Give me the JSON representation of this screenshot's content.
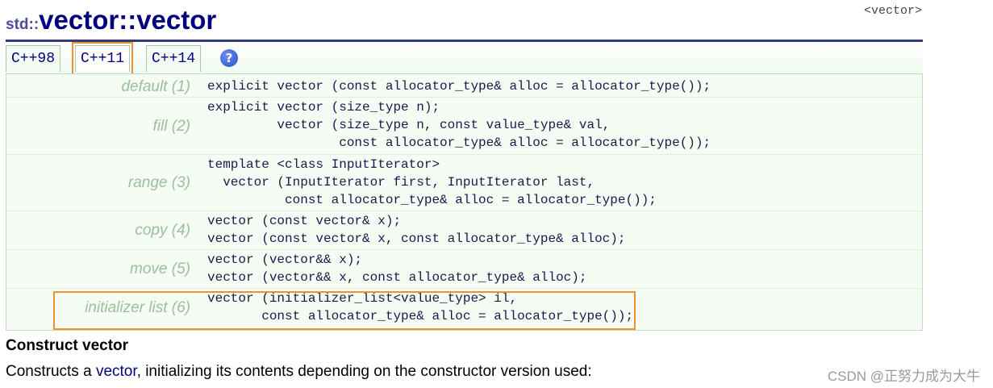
{
  "header": {
    "namespace": "std::",
    "class_name": "vector",
    "separator": "::",
    "member_name": "vector",
    "header_tag": "<vector>"
  },
  "tabs": [
    {
      "label": "C++98",
      "active": false
    },
    {
      "label": "C++11",
      "active": true
    },
    {
      "label": "C++14",
      "active": false
    }
  ],
  "help_icon": "?",
  "constructors": [
    {
      "label": "default (1)",
      "code": "explicit vector (const allocator_type& alloc = allocator_type());"
    },
    {
      "label": "fill (2)",
      "code": "explicit vector (size_type n);\n         vector (size_type n, const value_type& val,\n                 const allocator_type& alloc = allocator_type());"
    },
    {
      "label": "range (3)",
      "code": "template <class InputIterator>\n  vector (InputIterator first, InputIterator last,\n          const allocator_type& alloc = allocator_type());"
    },
    {
      "label": "copy (4)",
      "code": "vector (const vector& x);\nvector (const vector& x, const allocator_type& alloc);"
    },
    {
      "label": "move (5)",
      "code": "vector (vector&& x);\nvector (vector&& x, const allocator_type& alloc);"
    },
    {
      "label": "initializer list (6)",
      "code": "vector (initializer_list<value_type> il,\n       const allocator_type& alloc = allocator_type());"
    }
  ],
  "section": {
    "title": "Construct vector",
    "desc_prefix": "Constructs a ",
    "desc_link": "vector",
    "desc_suffix": ", initializing its contents depending on the constructor version used:"
  },
  "watermark": "CSDN @正努力成为大牛",
  "colors": {
    "highlight": "#f0922c",
    "title": "#000080",
    "label": "#9cbf9c"
  }
}
